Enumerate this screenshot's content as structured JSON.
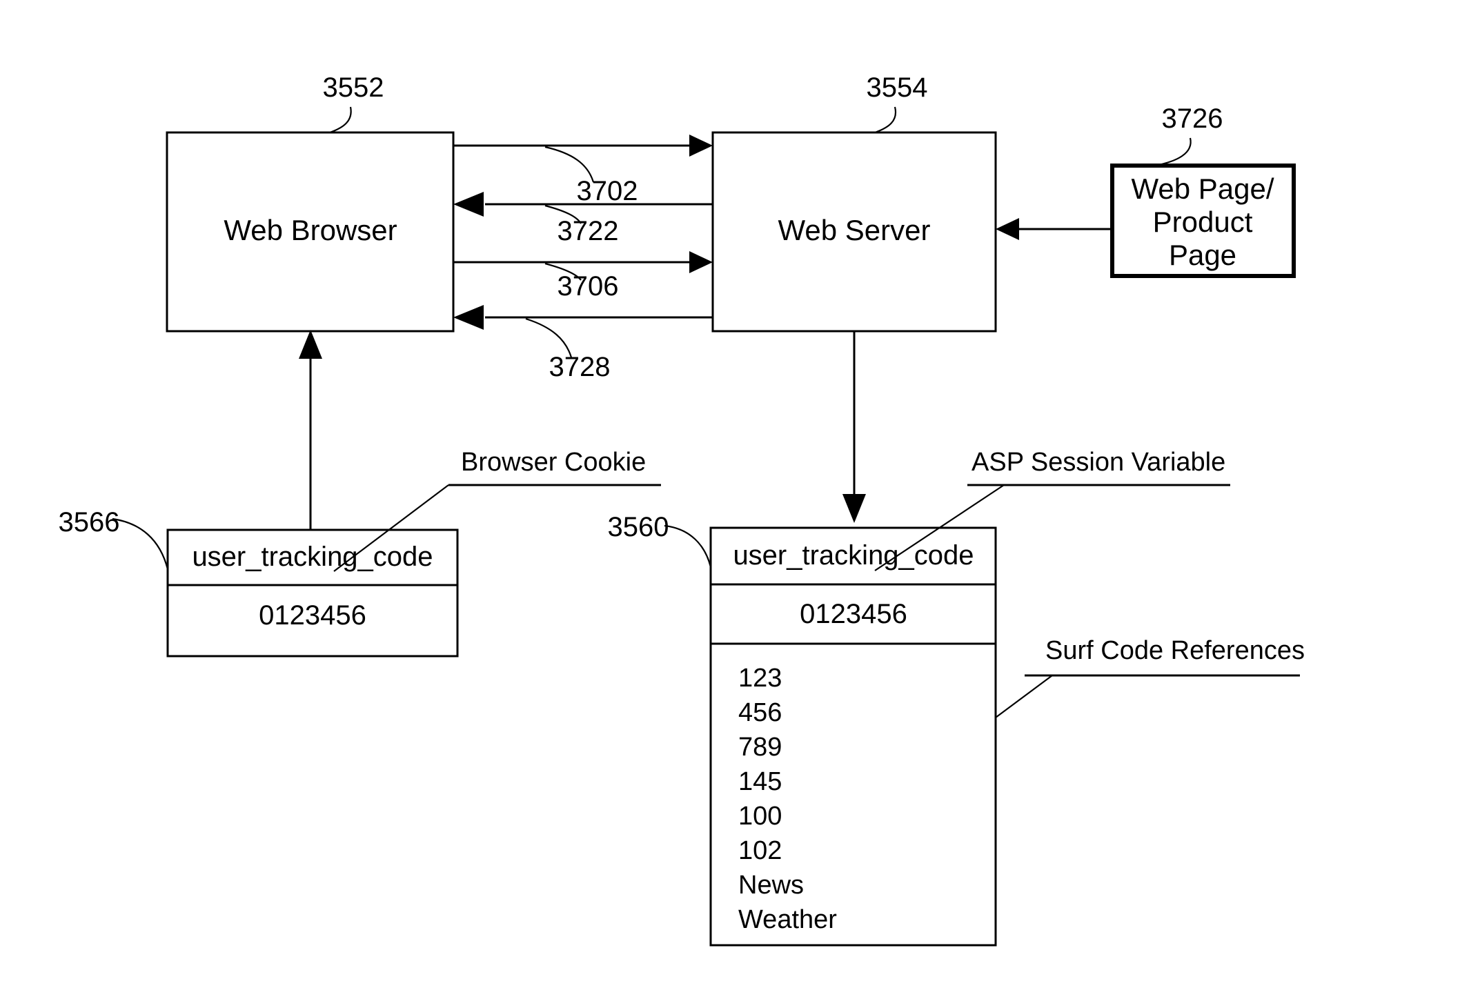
{
  "figure": {
    "title": "Web Browser / Web Server user tracking code diagram"
  },
  "nodes": {
    "web_browser": {
      "label": "Web Browser",
      "ref": "3552"
    },
    "web_server": {
      "label": "Web Server",
      "ref": "3554"
    },
    "web_page": {
      "label_line1": "Web Page/",
      "label_line2": "Product",
      "label_line3": "Page",
      "ref": "3726"
    },
    "browser_cookie_table": {
      "ref": "3566",
      "annotation": "Browser Cookie",
      "header": "user_tracking_code",
      "value": "0123456"
    },
    "session_variable_table": {
      "ref": "3560",
      "annotation": "ASP Session Variable",
      "annotation2": "Surf Code References",
      "header": "user_tracking_code",
      "value": "0123456",
      "surf_codes": [
        "123",
        "456",
        "789",
        "145",
        "100",
        "102",
        "News",
        "Weather"
      ]
    }
  },
  "flows": [
    {
      "ref": "3702",
      "direction": "browser-to-server"
    },
    {
      "ref": "3722",
      "direction": "server-to-browser"
    },
    {
      "ref": "3706",
      "direction": "browser-to-server"
    },
    {
      "ref": "3728",
      "direction": "server-to-browser"
    }
  ]
}
